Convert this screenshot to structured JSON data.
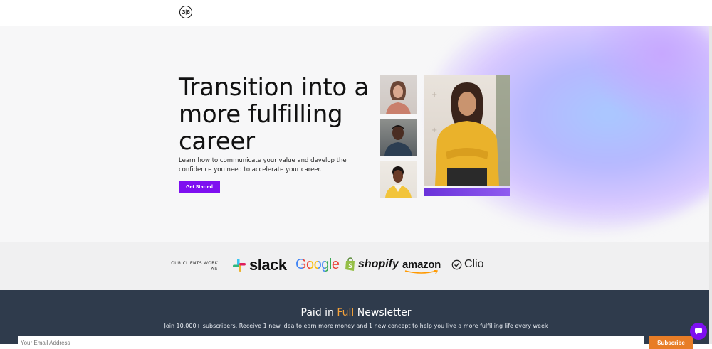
{
  "header": {
    "logo_text": "3|8"
  },
  "hero": {
    "title": "Transition into a more fulfilling career",
    "subtitle": "Learn how to communicate your value and develop the confidence you need to accelerate your career.",
    "cta_label": "Get Started"
  },
  "clients": {
    "label": "OUR CLIENTS WORK AT:",
    "brands": [
      "slack",
      "Google",
      "shopify",
      "amazon",
      "Clio"
    ]
  },
  "newsletter": {
    "title_pre": "Paid in ",
    "title_accent": "Full",
    "title_post": " Newsletter",
    "subtitle": "Join 10,000+ subscribers. Receive 1 new idea to earn more money and 1 new concept to help you live a more fulfilling life every week",
    "email_placeholder": "Your Email Address",
    "subscribe_label": "Subscribe"
  },
  "colors": {
    "accent_purple": "#7e0ff0",
    "accent_orange": "#f5a23a",
    "newsletter_bg": "#2f3b4c"
  }
}
